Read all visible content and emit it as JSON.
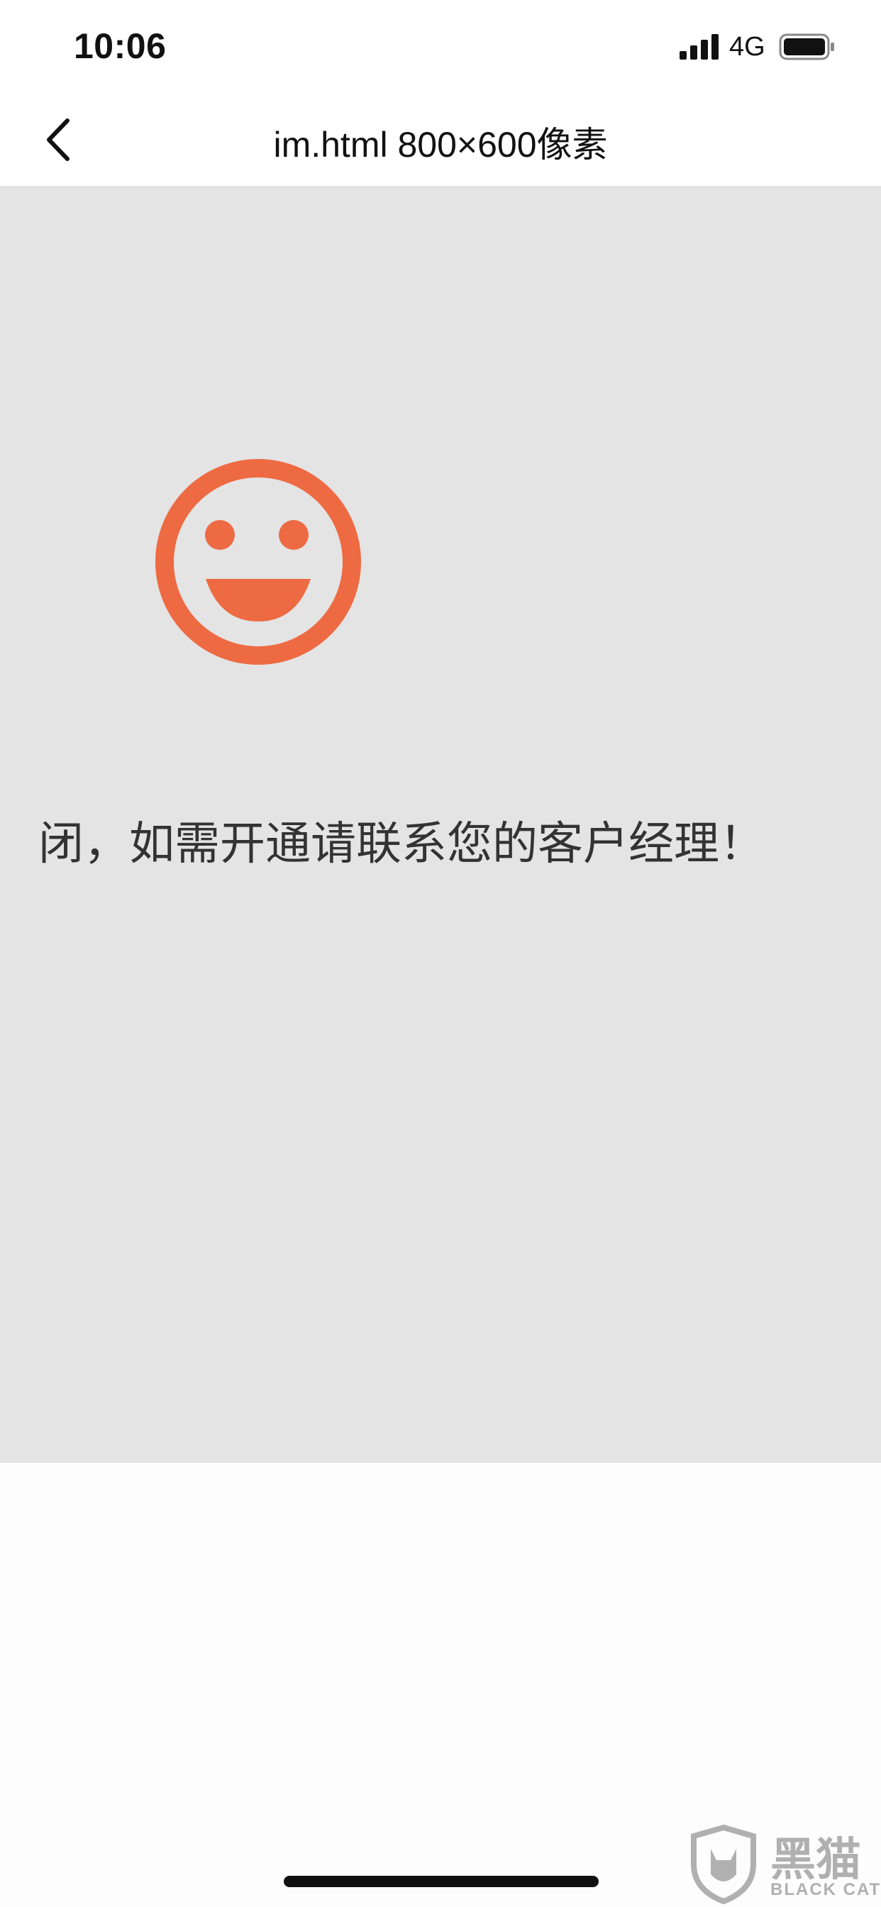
{
  "status_bar": {
    "time": "10:06",
    "network": "4G",
    "icons": [
      "signal-icon",
      "battery-icon"
    ]
  },
  "nav": {
    "back_icon": "chevron-left-icon",
    "title": "im.html 800×600像素"
  },
  "content": {
    "icon": "smile-icon",
    "icon_color": "#ee6a43",
    "message": "闭，如需开通请联系您的客户经理！",
    "background": "#e4e4e4"
  },
  "watermark": {
    "title": "黑猫",
    "subtitle": "BLACK CAT"
  }
}
